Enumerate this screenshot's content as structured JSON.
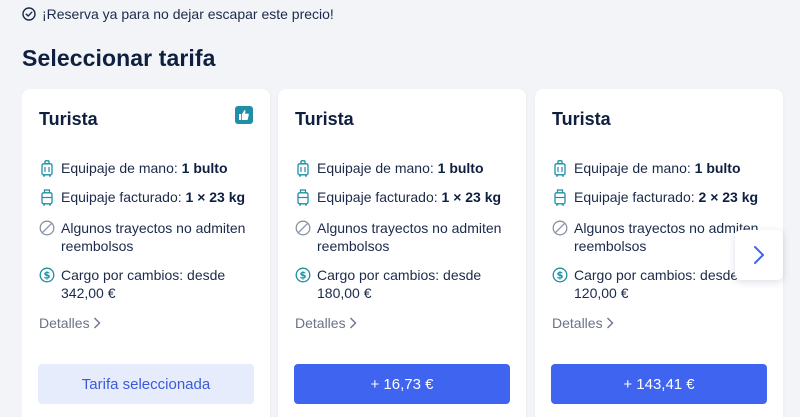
{
  "notice": {
    "text": "¡Reserva ya para no dejar escapar este precio!"
  },
  "page_title": "Seleccionar tarifa",
  "colors": {
    "accent": "#3e64f0",
    "selected_bg": "#e6ecfb",
    "badge": "#1e8fa6"
  },
  "cards": [
    {
      "name": "Turista",
      "hand_label": "Equipaje de mano: ",
      "hand_value": "1 bulto",
      "checked_label": "Equipaje facturado: ",
      "checked_value": "1 × 23 kg",
      "refund": "Algunos trayectos no admiten reembolsos",
      "change_label": "Cargo por cambios: desde",
      "change_value": "342,00 €",
      "details": "Detalles",
      "button": "Tarifa seleccionada"
    },
    {
      "name": "Turista",
      "hand_label": "Equipaje de mano: ",
      "hand_value": "1 bulto",
      "checked_label": "Equipaje facturado: ",
      "checked_value": "1 × 23 kg",
      "refund": "Algunos trayectos no admiten reembolsos",
      "change_label": "Cargo por cambios: desde",
      "change_value": "180,00 €",
      "details": "Detalles",
      "button": "+ 16,73 €"
    },
    {
      "name": "Turista",
      "hand_label": "Equipaje de mano: ",
      "hand_value": "1 bulto",
      "checked_label": "Equipaje facturado: ",
      "checked_value": "2 × 23 kg",
      "refund": "Algunos trayectos no admiten reembolsos",
      "change_label": "Cargo por cambios: desde",
      "change_value": "120,00 €",
      "details": "Detalles",
      "button": "+ 143,41 €"
    }
  ]
}
